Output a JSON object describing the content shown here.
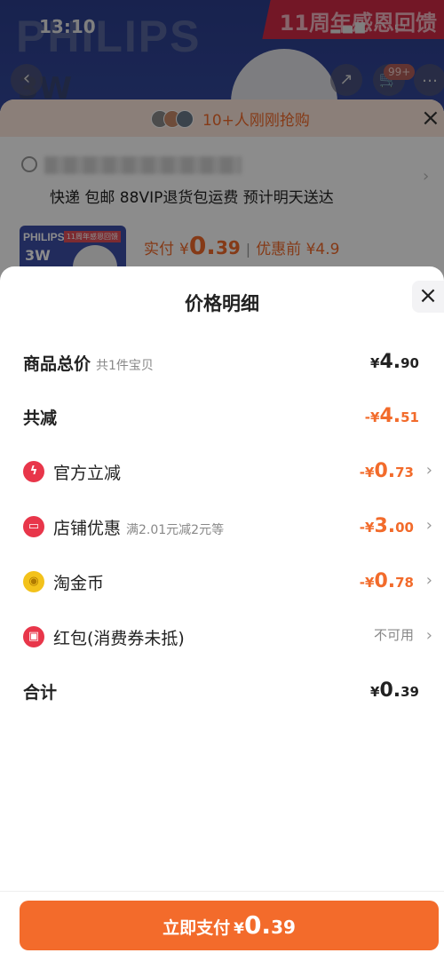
{
  "status_bar": {
    "time": "13:10",
    "icons": "▂▄▆ ◠ ▭"
  },
  "product_page": {
    "brand": "PHILIPS",
    "anniversary": "11周年感恩回馈",
    "product_big": "3W",
    "back_glyph": "‹",
    "share_glyph": "↗",
    "cart_glyph": "🛒",
    "cart_badge": "99+",
    "more_glyph": "…",
    "hot_text": "10+人刚刚抢购",
    "close_glyph": "×",
    "shipping": "快递 包邮 88VIP退货包运费 预计明天送达",
    "thumb_brand": "PHILIPS",
    "thumb_tag": "11周年感恩回馈",
    "thumb_3w": "3W",
    "price_label": "实付",
    "price_yen": "¥",
    "price_int": "0.",
    "price_dec": "39",
    "price_sep": "|",
    "original_price": "优惠前 ¥4.9"
  },
  "sheet": {
    "title": "价格明细",
    "close_glyph": "×",
    "rows": [
      {
        "label": "商品总价",
        "sub": "共1件宝贝",
        "yen": "¥",
        "int": "4.",
        "dec": "90"
      },
      {
        "label": "共减",
        "yen": "-¥",
        "int": "4.",
        "dec": "51"
      },
      {
        "label": "官方立减",
        "yen": "-¥",
        "int": "0.",
        "dec": "73",
        "icon": "ϟ",
        "icon_color": "#e8364a"
      },
      {
        "label": "店铺优惠",
        "sub": "满2.01元减2元等",
        "yen": "-¥",
        "int": "3.",
        "dec": "00",
        "icon": "▭",
        "icon_color": "#e8364a"
      },
      {
        "label": "淘金币",
        "yen": "-¥",
        "int": "0.",
        "dec": "78",
        "icon": "◉",
        "icon_color": "#f3c21b"
      },
      {
        "label": "红包(消费券未抵)",
        "value_text": "不可用",
        "icon": "▣",
        "icon_color": "#e8364a"
      },
      {
        "label": "合计",
        "yen": "¥",
        "int": "0.",
        "dec": "39"
      }
    ],
    "arrow_glyph": "›"
  },
  "footer": {
    "pay_label": "立即支付",
    "pay_yen": "¥",
    "pay_int": "0.",
    "pay_dec": "39"
  },
  "colors": {
    "accent": "#f36b2b",
    "price_orange": "#f26b2b",
    "red_icon": "#e8364a",
    "coin": "#f3c21b"
  }
}
